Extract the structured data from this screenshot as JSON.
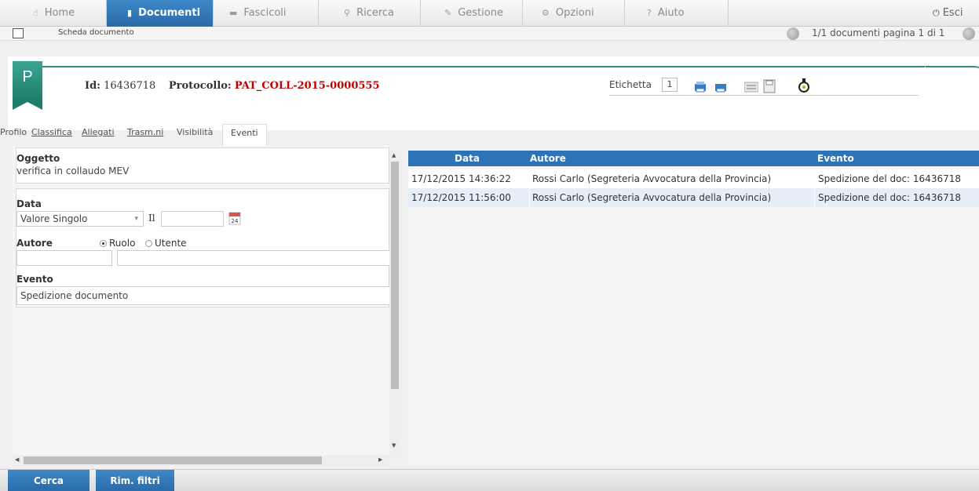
{
  "nav": {
    "home": "Home",
    "documenti": "Documenti",
    "fascicoli": "Fascicoli",
    "ricerca": "Ricerca",
    "gestione": "Gestione",
    "opzioni": "Opzioni",
    "aiuto": "Aiuto",
    "esci": "Esci"
  },
  "breadcrumb": "Scheda documento",
  "pagination": "1/1 documenti pagina 1 di 1",
  "document": {
    "badge": "P",
    "id_label": "Id:",
    "id_value": "16436718",
    "protocol_label": "Protocollo:",
    "protocol_value": "PAT_COLL-2015-0000555",
    "etichetta_label": "Etichetta",
    "etichetta_value": "1"
  },
  "tabs": [
    "Profilo",
    "Classifica",
    "Allegati",
    "Trasm.ni",
    "Visibilità",
    "Eventi"
  ],
  "filters": {
    "oggetto_label": "Oggetto",
    "oggetto_value": "verifica in collaudo MEV",
    "data_label": "Data",
    "data_select": "Valore Singolo",
    "data_il": "Il",
    "autore_label": "Autore",
    "radio_ruolo": "Ruolo",
    "radio_utente": "Utente",
    "evento_label": "Evento",
    "evento_value": "Spedizione documento"
  },
  "table": {
    "headers": [
      "Data",
      "Autore",
      "Evento"
    ],
    "rows": [
      [
        "17/12/2015 14:36:22",
        "Rossi Carlo (Segreteria Avvocatura della Provincia)",
        "Spedizione del doc: 16436718"
      ],
      [
        "17/12/2015 11:56:00",
        "Rossi Carlo (Segreteria Avvocatura della Provincia)",
        "Spedizione del doc: 16436718"
      ]
    ]
  },
  "buttons": {
    "cerca": "Cerca",
    "rim_filtri": "Rim. filtri"
  }
}
